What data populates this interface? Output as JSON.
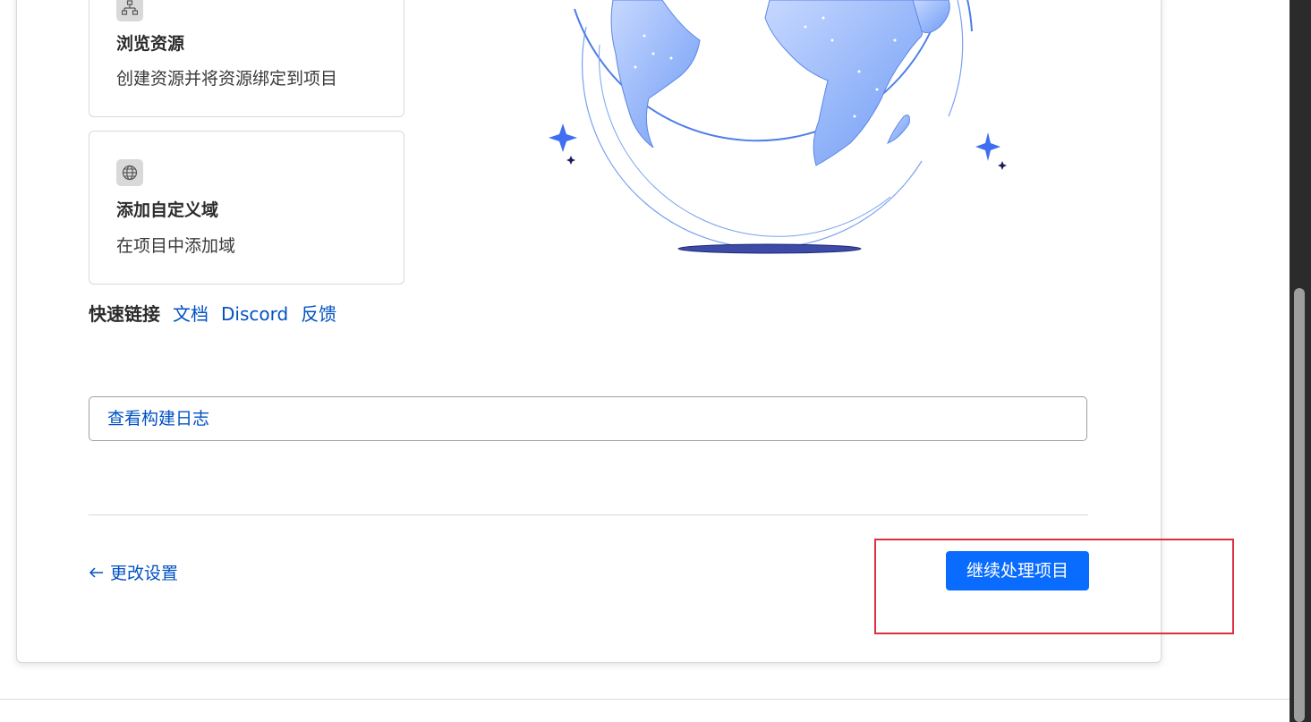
{
  "tiles": [
    {
      "title": "浏览资源",
      "description": "创建资源并将资源绑定到项目",
      "icon": "network-icon"
    },
    {
      "title": "添加自定义域",
      "description": "在项目中添加域",
      "icon": "globe-icon"
    }
  ],
  "quick_links": {
    "label": "快速链接",
    "links": [
      "文档",
      "Discord",
      "反馈"
    ]
  },
  "build_log_button": "查看构建日志",
  "back_link": "更改设置",
  "continue_button": "继续处理项目",
  "colors": {
    "accent": "#0a6cff",
    "link": "#0051c3",
    "highlight": "#d9303f"
  }
}
